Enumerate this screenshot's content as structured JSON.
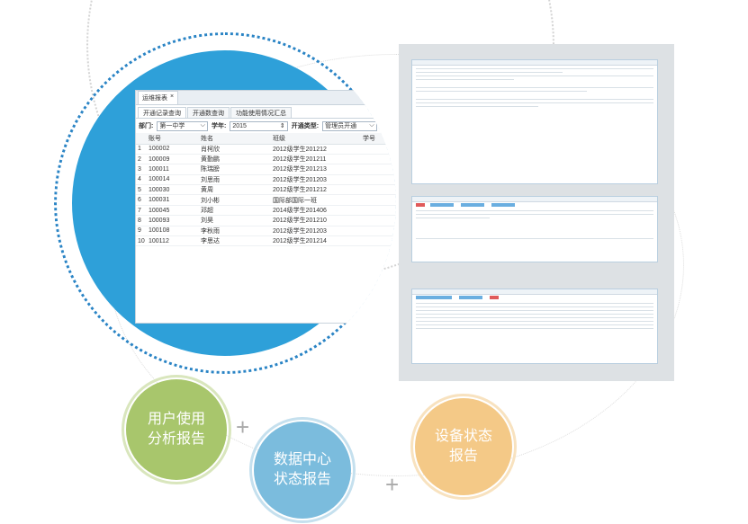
{
  "window_tab": {
    "label": "运维报表",
    "close": "×"
  },
  "sub_tabs": [
    "开通记录查询",
    "开通数查询",
    "功能使用情况汇总"
  ],
  "filters": {
    "dept_label": "部门:",
    "dept_value": "第一中学",
    "year_label": "学年:",
    "year_value": "2015",
    "type_label": "开通类型:",
    "type_value": "管理员开通"
  },
  "table": {
    "headers": [
      "",
      "账号",
      "姓名",
      "班级",
      "学号"
    ],
    "rows": [
      [
        "1",
        "100002",
        "肖柯欣",
        "2012级学生201212",
        ""
      ],
      [
        "2",
        "100009",
        "黄勤鹏",
        "2012级学生201211",
        ""
      ],
      [
        "3",
        "100011",
        "陈瑞膀",
        "2012级学生201213",
        ""
      ],
      [
        "4",
        "100014",
        "刘思雨",
        "2012级学生201203",
        ""
      ],
      [
        "5",
        "100030",
        "黄周",
        "2012级学生201212",
        ""
      ],
      [
        "6",
        "100031",
        "刘小彬",
        "国际部国际一班",
        ""
      ],
      [
        "7",
        "100045",
        "邓超",
        "2014级学生201406",
        ""
      ],
      [
        "8",
        "100093",
        "刘昊",
        "2012级学生201210",
        ""
      ],
      [
        "9",
        "100108",
        "李秋雨",
        "2012级学生201203",
        ""
      ],
      [
        "10",
        "100112",
        "李思达",
        "2012级学生201214",
        ""
      ]
    ]
  },
  "badges": [
    {
      "text": "用户使用\n分析报告",
      "color": "#a8c66c"
    },
    {
      "text": "数据中心\n状态报告",
      "color": "#7bbcdd"
    },
    {
      "text": "设备状态\n报告",
      "color": "#f4c987"
    }
  ],
  "plus_sign": "+",
  "colors": {
    "blue_circle": "#2ea0d9",
    "dots": "#2a84c5",
    "panel": "#dde1e4"
  }
}
